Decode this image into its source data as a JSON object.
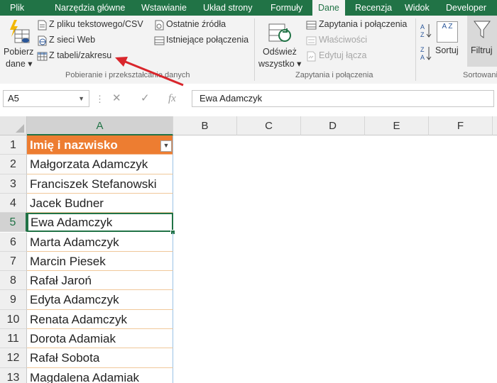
{
  "ribbon_tabs": [
    "Plik",
    "Narzędzia główne",
    "Wstawianie",
    "Układ strony",
    "Formuły",
    "Dane",
    "Recenzja",
    "Widok",
    "Developer"
  ],
  "active_tab": "Dane",
  "ribbon": {
    "get_data": {
      "line1": "Pobierz",
      "line2": "dane"
    },
    "from_text_csv": "Z pliku tekstowego/CSV",
    "from_web": "Z sieci Web",
    "from_table": "Z tabeli/zakresu",
    "recent_sources": "Ostatnie źródła",
    "existing_connections": "Istniejące połączenia",
    "group_get_transform": "Pobieranie i przekształcanie danych",
    "refresh_all": {
      "line1": "Odśwież",
      "line2": "wszystko"
    },
    "queries_connections": "Zapytania i połączenia",
    "properties": "Właściwości",
    "edit_links": "Edytuj łącza",
    "group_queries": "Zapytania i połączenia",
    "sort_az": "A Z",
    "sort": "Sortuj",
    "filter": "Filtruj",
    "group_sort": "Sortowanie"
  },
  "formula_bar": {
    "name_box": "A5",
    "cancel": "✕",
    "enter": "✓",
    "fx": "fx",
    "value": "Ewa Adamczyk"
  },
  "columns": [
    "A",
    "B",
    "C",
    "D",
    "E",
    "F"
  ],
  "selected_cell": "A5",
  "rows": [
    {
      "n": "1",
      "a": "Imię i nazwisko"
    },
    {
      "n": "2",
      "a": "Małgorzata Adamczyk"
    },
    {
      "n": "3",
      "a": "Franciszek Stefanowski"
    },
    {
      "n": "4",
      "a": "Jacek Budner"
    },
    {
      "n": "5",
      "a": "Ewa Adamczyk"
    },
    {
      "n": "6",
      "a": "Marta Adamczyk"
    },
    {
      "n": "7",
      "a": "Marcin Piesek"
    },
    {
      "n": "8",
      "a": "Rafał Jaroń"
    },
    {
      "n": "9",
      "a": "Edyta Adamczyk"
    },
    {
      "n": "10",
      "a": "Renata Adamczyk"
    },
    {
      "n": "11",
      "a": "Dorota Adamiak"
    },
    {
      "n": "12",
      "a": "Rafał Sobota"
    },
    {
      "n": "13",
      "a": "Magdalena Adamiak"
    }
  ],
  "colors": {
    "excel_green": "#217346",
    "table_header": "#ed7d31",
    "arrow": "#d9262c"
  }
}
